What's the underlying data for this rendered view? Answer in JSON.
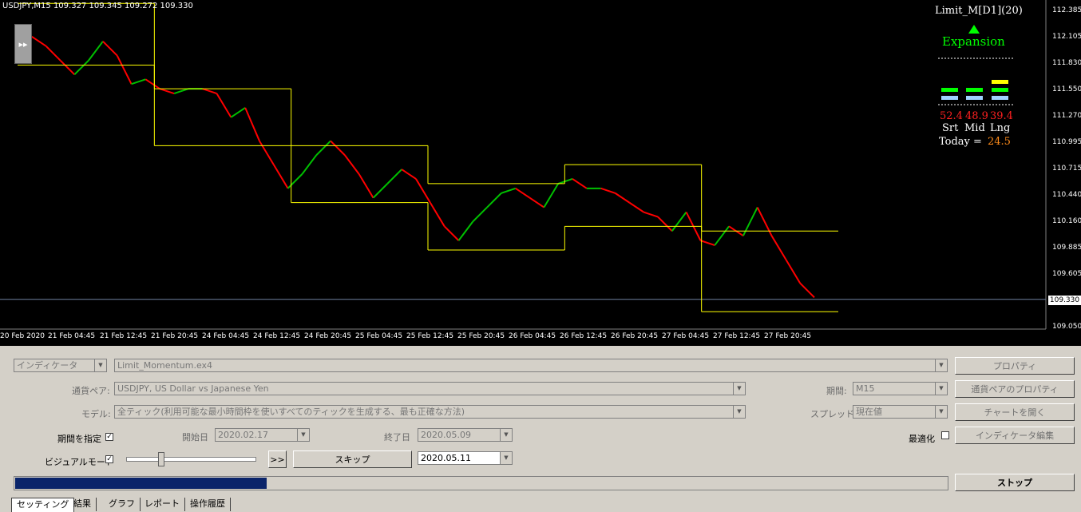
{
  "chart": {
    "symbol_header": "USDJPY,M15  109.327 109.345 109.272 109.330",
    "ff_icon": "fast-forward-icon",
    "indicator": {
      "title": "Limit_M[D1](20)",
      "state": "Expansion",
      "values": [
        "52.4",
        "48.9",
        "39.4"
      ],
      "labels": [
        "Srt",
        "Mid",
        "Lng"
      ],
      "today_label": "Today =",
      "today_value": "24.5",
      "colors": {
        "up": "#00ff00",
        "down": "#ff0000",
        "bar_light": "#9fd2ff",
        "bar_yellow": "#ffff00"
      }
    },
    "price_axis": [
      "112.385",
      "112.105",
      "111.830",
      "111.550",
      "111.270",
      "110.995",
      "110.715",
      "110.440",
      "110.160",
      "109.885",
      "109.605",
      "109.330",
      "109.050"
    ],
    "current_price": "109.330",
    "time_axis": [
      "20 Feb 2020",
      "21 Feb 04:45",
      "21 Feb 12:45",
      "21 Feb 20:45",
      "24 Feb 04:45",
      "24 Feb 12:45",
      "24 Feb 20:45",
      "25 Feb 04:45",
      "25 Feb 12:45",
      "25 Feb 20:45",
      "26 Feb 04:45",
      "26 Feb 12:45",
      "26 Feb 20:45",
      "27 Feb 04:45",
      "27 Feb 12:45",
      "27 Feb 20:45"
    ],
    "colors": {
      "background": "#000000",
      "band": "#ffff00",
      "bull": "#00c000",
      "bear": "#ff0000",
      "neutral": "#0000ff"
    }
  },
  "chart_data": {
    "type": "line",
    "title": "USDJPY,M15",
    "ylim": [
      109.05,
      112.385
    ],
    "series": [
      {
        "values": [
          111.95,
          112.1,
          112.0,
          111.85,
          111.7,
          111.85,
          112.05,
          111.9,
          111.6,
          111.65,
          111.55,
          111.5,
          111.55,
          111.55,
          111.5,
          111.25,
          111.35,
          111.0,
          110.75,
          110.5,
          110.65,
          110.85,
          111.0,
          110.85,
          110.65,
          110.4,
          110.55,
          110.7,
          110.6,
          110.35,
          110.1,
          109.95,
          110.15,
          110.3,
          110.45,
          110.5,
          110.4,
          110.3,
          110.55,
          110.6,
          110.5,
          110.5,
          110.45,
          110.35,
          110.25,
          110.2,
          110.05,
          110.25,
          109.95,
          109.9,
          110.1,
          110.0,
          110.3,
          110.0,
          109.75,
          109.5,
          109.35
        ]
      }
    ],
    "bands": {
      "upper": [
        112.45,
        111.55,
        110.95,
        110.55,
        110.75,
        110.05
      ],
      "lower": [
        111.8,
        110.95,
        110.35,
        109.85,
        110.1,
        109.2
      ]
    }
  },
  "panel": {
    "type_select": "インディケータ",
    "file_select": "Limit_Momentum.ex4",
    "properties_button": "プロパティ",
    "pair_label": "通貨ペア:",
    "pair_value": "USDJPY, US Dollar vs Japanese Yen",
    "period_label": "期間:",
    "period_value": "M15",
    "pair_props_button": "通貨ペアのプロパティ",
    "model_label": "モデル:",
    "model_value": "全ティック(利用可能な最小時間枠を使いすべてのティックを生成する、最も正確な方法)",
    "spread_label": "スプレッド:",
    "spread_value": "現在値",
    "open_chart_button": "チャートを開く",
    "use_date_label": "期間を指定",
    "start_label": "開始日",
    "start_value": "2020.02.17",
    "end_label": "終了日",
    "end_value": "2020.05.09",
    "optimize_label": "最適化",
    "edit_indicator_button": "インディケータ編集",
    "visual_label": "ビジュアルモード",
    "ff_button": ">>",
    "skip_button": "スキップ",
    "skip_date": "2020.05.11",
    "stop_button": "ストップ",
    "progress": 0.27,
    "tabs": [
      "セッティング",
      "結果",
      "グラフ",
      "レポート",
      "操作履歴"
    ]
  }
}
